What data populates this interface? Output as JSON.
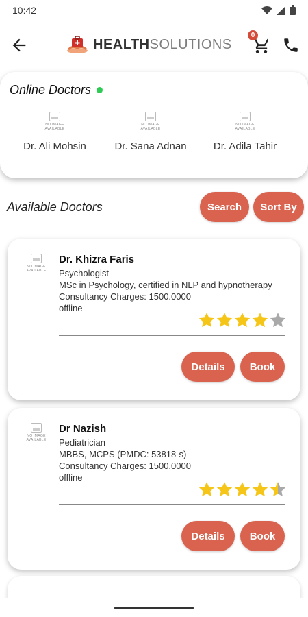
{
  "status_bar": {
    "time": "10:42"
  },
  "app_bar": {
    "brand_bold": "HEALTH",
    "brand_light": "SOLUTIONS",
    "cart_count": "0",
    "icons": {
      "back": "back-arrow-icon",
      "cart": "cart-icon",
      "phone": "phone-icon"
    }
  },
  "online": {
    "title": "Online Doctors",
    "status_color": "#2ecc55",
    "doctors": [
      {
        "name": "Dr. Ali Mohsin"
      },
      {
        "name": "Dr. Sana Adnan"
      },
      {
        "name": "Dr. Adila Tahir"
      }
    ]
  },
  "no_image_label": "NO IMAGE AVAILABLE",
  "available": {
    "title": "Available Doctors",
    "search_label": "Search",
    "sort_label": "Sort By"
  },
  "accent_color": "#d9634f",
  "star_color": "#f5c518",
  "cards": [
    {
      "name": "Dr. Khizra Faris",
      "specialty": "Psychologist",
      "qualification": "MSc in Psychology, certified in NLP and hypnotherapy",
      "charges": "Consultancy Charges: 1500.0000",
      "status": "offline",
      "rating": 4,
      "details_label": "Details",
      "book_label": "Book"
    },
    {
      "name": "Dr Nazish",
      "specialty": "Pediatrician",
      "qualification": "MBBS, MCPS (PMDC: 53818-s)",
      "charges": "Consultancy Charges: 1500.0000",
      "status": "offline",
      "rating": 4.5,
      "details_label": "Details",
      "book_label": "Book"
    }
  ]
}
